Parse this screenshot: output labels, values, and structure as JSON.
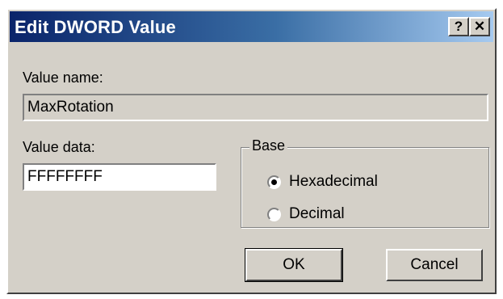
{
  "window": {
    "title": "Edit DWORD Value",
    "help_label": "?",
    "close_label": "✕"
  },
  "value_name": {
    "label": "Value name:",
    "value": "MaxRotation"
  },
  "value_data": {
    "label": "Value data:",
    "value": "FFFFFFFF"
  },
  "base": {
    "legend": "Base",
    "options": [
      {
        "label": "Hexadecimal",
        "selected": true
      },
      {
        "label": "Decimal",
        "selected": false
      }
    ]
  },
  "buttons": {
    "ok": "OK",
    "cancel": "Cancel"
  },
  "colors": {
    "face": "#d4d0c8",
    "title_start": "#0a246a",
    "title_end": "#a6caf0"
  }
}
